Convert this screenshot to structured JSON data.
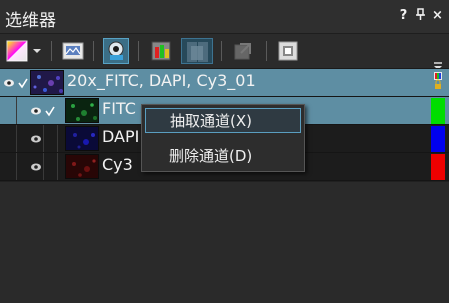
{
  "window": {
    "title": "选维器",
    "controls": [
      "?",
      "⊕",
      "×"
    ]
  },
  "toolbar": {
    "buttons": [
      "colormap-button",
      "dropdown-button",
      "image-button",
      "view-button",
      "channel-button",
      "split-button",
      "export-button",
      "settings-button"
    ]
  },
  "tree": {
    "rows": [
      {
        "label": "20x_FITC, DAPI, Cy3_01",
        "type": "parent",
        "selected": true
      },
      {
        "label": "FITC",
        "type": "channel",
        "selected": true,
        "color": "#00dd00"
      },
      {
        "label": "DAPI",
        "type": "channel",
        "selected": false,
        "color": "#0000ee"
      },
      {
        "label": "Cy3",
        "type": "channel",
        "selected": false,
        "color": "#ee0000"
      }
    ]
  },
  "context_menu": {
    "items": [
      {
        "label": "抽取通道(X)",
        "hover": true
      },
      {
        "label": "删除通道(D)",
        "hover": false
      }
    ]
  }
}
